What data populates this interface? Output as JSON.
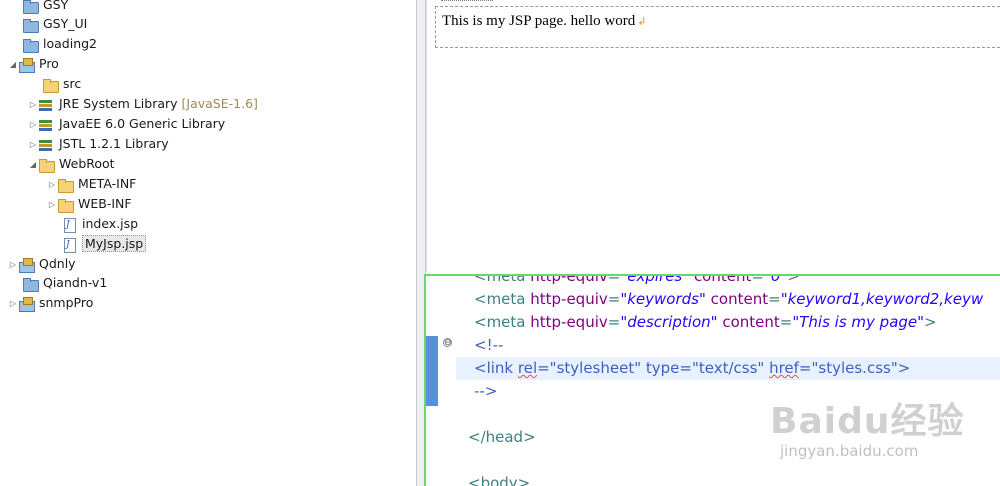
{
  "explorer": {
    "items": [
      {
        "label": "GSY",
        "arrow": "",
        "icon": "folder-icon",
        "deco": ""
      },
      {
        "label": "GSY_UI",
        "arrow": "",
        "icon": "folder-icon",
        "deco": ""
      },
      {
        "label": "loading2",
        "arrow": "",
        "icon": "folder-icon",
        "deco": ""
      },
      {
        "label": "Pro",
        "arrow": "◢",
        "icon": "project-icon",
        "deco": ""
      },
      {
        "label": "src",
        "arrow": "",
        "icon": "source-folder-icon",
        "deco": ""
      },
      {
        "label": "JRE System Library",
        "arrow": "▷",
        "icon": "library-icon",
        "deco": "[JavaSE-1.6]"
      },
      {
        "label": "JavaEE 6.0 Generic Library",
        "arrow": "▷",
        "icon": "library-icon",
        "deco": ""
      },
      {
        "label": "JSTL 1.2.1 Library",
        "arrow": "▷",
        "icon": "library-icon",
        "deco": ""
      },
      {
        "label": "WebRoot",
        "arrow": "◢",
        "icon": "folder-open-icon",
        "deco": ""
      },
      {
        "label": "META-INF",
        "arrow": "▷",
        "icon": "folder-open-icon",
        "deco": ""
      },
      {
        "label": "WEB-INF",
        "arrow": "▷",
        "icon": "folder-open-icon",
        "deco": ""
      },
      {
        "label": "index.jsp",
        "arrow": "",
        "icon": "jsp-file-icon",
        "deco": ""
      },
      {
        "label": "MyJsp.jsp",
        "arrow": "",
        "icon": "jsp-file-icon",
        "deco": ""
      },
      {
        "label": "Qdnly",
        "arrow": "▷",
        "icon": "project-icon",
        "deco": ""
      },
      {
        "label": "Qiandn-v1",
        "arrow": "",
        "icon": "folder-icon",
        "deco": ""
      },
      {
        "label": "snmpPro",
        "arrow": "▷",
        "icon": "project-icon",
        "deco": ""
      }
    ]
  },
  "preview": {
    "text": "This is my JSP page. hello word",
    "pilcrow": "↲"
  },
  "editor": {
    "fold_marker": "⊖",
    "line0": {
      "open": "<meta ",
      "attr1": "http-equiv",
      "eq1": "=",
      "val1": "\"expires\"",
      "sp": " ",
      "attr2": "content",
      "eq2": "=",
      "val2": "\"0\"",
      "close": ">"
    },
    "line1": {
      "open": "<meta ",
      "attr1": "http-equiv",
      "eq1": "=",
      "val1": "\"keywords\"",
      "sp": " ",
      "attr2": "content",
      "eq2": "=",
      "val2": "\"keyword1,keyword2,keyw"
    },
    "line2": {
      "open": "<meta ",
      "attr1": "http-equiv",
      "eq1": "=",
      "val1": "\"description\"",
      "sp": " ",
      "attr2": "content",
      "eq2": "=",
      "val2": "\"This is my page\"",
      "close": ">"
    },
    "line3": "<!--",
    "line4": {
      "a": "<link ",
      "rel": "rel",
      "b": "=\"stylesheet\" type=\"text/css\" ",
      "href": "href",
      "c": "=\"styles.css\">"
    },
    "line5": "-->",
    "line6": "",
    "line7": "</head>",
    "line8": "",
    "line9": "<body>"
  },
  "watermark": {
    "logo": "Baidu经验",
    "url": "jingyan.baidu.com"
  },
  "colors": {
    "editor_border": "#6fd46f",
    "tag": "#3f7f7f",
    "attr": "#7f007f",
    "value": "#2a00ff",
    "comment": "#3f5fbf"
  }
}
